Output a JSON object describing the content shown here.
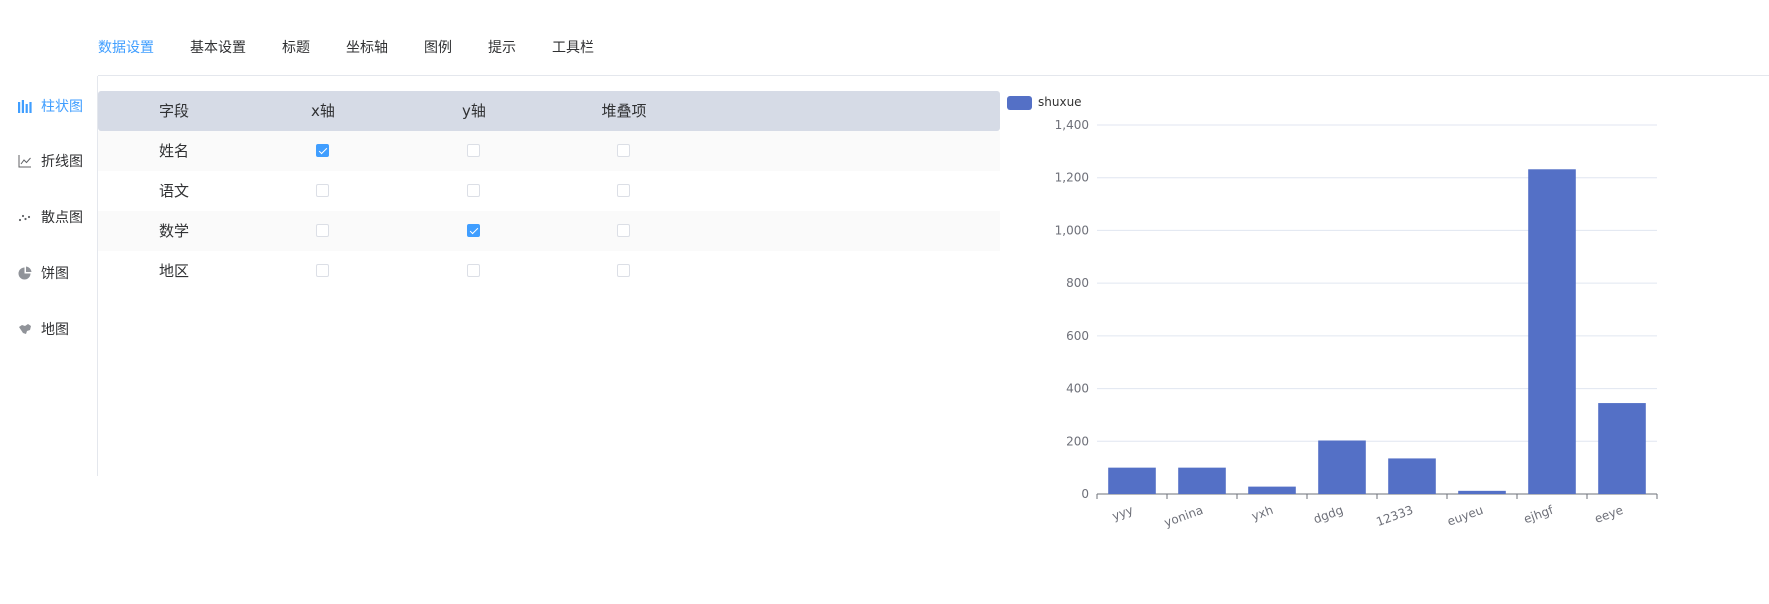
{
  "tabs": [
    {
      "label": "数据设置",
      "active": true
    },
    {
      "label": "基本设置",
      "active": false
    },
    {
      "label": "标题",
      "active": false
    },
    {
      "label": "坐标轴",
      "active": false
    },
    {
      "label": "图例",
      "active": false
    },
    {
      "label": "提示",
      "active": false
    },
    {
      "label": "工具栏",
      "active": false
    }
  ],
  "sidebar": {
    "items": [
      {
        "label": "柱状图",
        "icon": "bar-chart-icon",
        "active": true
      },
      {
        "label": "折线图",
        "icon": "line-chart-icon",
        "active": false
      },
      {
        "label": "散点图",
        "icon": "scatter-chart-icon",
        "active": false
      },
      {
        "label": "饼图",
        "icon": "pie-chart-icon",
        "active": false
      },
      {
        "label": "地图",
        "icon": "map-icon",
        "active": false
      }
    ]
  },
  "table": {
    "headers": [
      "字段",
      "x轴",
      "y轴",
      "堆叠项"
    ],
    "rows": [
      {
        "field": "姓名",
        "x": true,
        "y": false,
        "stack": false
      },
      {
        "field": "语文",
        "x": false,
        "y": false,
        "stack": false
      },
      {
        "field": "数学",
        "x": false,
        "y": true,
        "stack": false
      },
      {
        "field": "地区",
        "x": false,
        "y": false,
        "stack": false
      }
    ]
  },
  "colors": {
    "accent": "#409eff",
    "series": "#5470c6",
    "header_bg": "#d6dbe6"
  },
  "chart_data": {
    "type": "bar",
    "categories": [
      "yyy",
      "yonina",
      "yxh",
      "dgdg",
      "12333",
      "euyeu",
      "ejhgf",
      "eeye"
    ],
    "series": [
      {
        "name": "shuxue",
        "values": [
          100,
          100,
          28,
          203,
          135,
          12,
          1232,
          345
        ]
      }
    ],
    "ylim": [
      0,
      1400
    ],
    "yticks": [
      "0",
      "200",
      "400",
      "600",
      "800",
      "1,000",
      "1,200",
      "1,400"
    ],
    "grid": true,
    "legend": "top-left",
    "title": "",
    "xlabel": "",
    "ylabel": ""
  }
}
